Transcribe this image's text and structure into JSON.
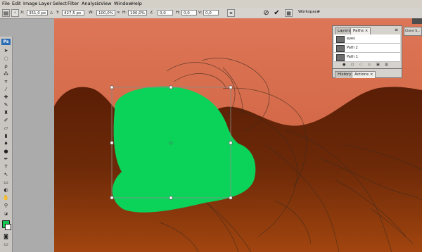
{
  "menu": [
    "File",
    "Edit",
    "Image",
    "Layer",
    "Select",
    "Filter",
    "Analysis",
    "View",
    "Window",
    "Help"
  ],
  "options": {
    "x_label": "X:",
    "x_value": "351,0 px",
    "y_label": "Y:",
    "y_value": "427,5 px",
    "w_label": "W:",
    "w_value": "100,0%",
    "h_label": "H:",
    "h_value": "100,0%",
    "angle_value": "0,0",
    "hskew_label": "H:",
    "hskew_value": "0,0",
    "vskew_label": "V:",
    "vskew_value": "0,0",
    "workspace_label": "Workspace"
  },
  "toolbox": {
    "logo": "Ps"
  },
  "panels": {
    "tabs": [
      "Layers",
      "Paths"
    ],
    "paths": [
      "eyes",
      "Path 2",
      "Path 1"
    ],
    "tabs2": [
      "History",
      "Actions"
    ],
    "clone_label": "Clone S..."
  },
  "colors": {
    "foreground": "#11c650",
    "shape": "#0bd35a",
    "sky_top": "#d96e4e",
    "hill": "#5a1e06"
  }
}
